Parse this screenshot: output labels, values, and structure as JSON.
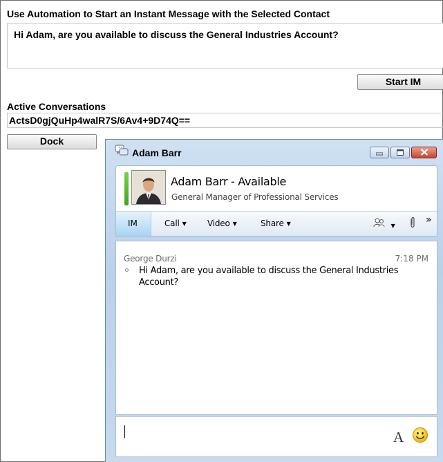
{
  "automation": {
    "title": "Use Automation to Start an Instant Message with the Selected Contact",
    "message_text": "Hi Adam, are you available to discuss the General Industries Account?",
    "start_im_label": "Start IM",
    "active_label": "Active Conversations",
    "active_id": "ActsD0gjQuHp4walR7S/6Av4+9D74Q==",
    "dock_label": "Dock"
  },
  "lync": {
    "window_title": "Adam Barr",
    "contact": {
      "name_status": "Adam Barr - Available",
      "job_title": "General Manager of Professional Services",
      "presence_color": "#4cb82a"
    },
    "toolbar": {
      "im": "IM",
      "call": "Call",
      "video": "Video",
      "share": "Share",
      "more": "»"
    },
    "messages": [
      {
        "sender": "George Durzi",
        "time": "7:18 PM",
        "text": "Hi Adam, are you available to discuss the General Industries Account?"
      }
    ],
    "compose": {
      "font_button": "A",
      "emoticon": "smiley-icon"
    }
  },
  "colors": {
    "lync_chrome": "#c3d8ee",
    "close_button": "#c8452b",
    "im_tab": "#a9d4f4"
  }
}
